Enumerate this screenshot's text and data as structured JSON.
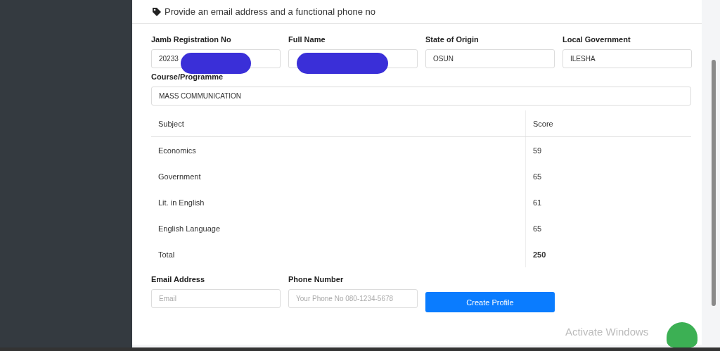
{
  "notice": "Provide an email address and a functional phone no",
  "fields": [
    {
      "label": "Jamb Registration No",
      "value": "20233",
      "redacted": true
    },
    {
      "label": "Full Name",
      "redacted": true
    },
    {
      "label": "State of Origin",
      "value": "OSUN",
      "redacted": false
    },
    {
      "label": "Local Government",
      "value": "ILESHA",
      "redacted": false
    }
  ],
  "course": {
    "label": "Course/Programme",
    "value": "MASS COMMUNICATION"
  },
  "table": {
    "columns": [
      "Subject",
      "Score"
    ],
    "rows": [
      {
        "subject": "Economics",
        "score": "59"
      },
      {
        "subject": "Government",
        "score": "65"
      },
      {
        "subject": "Lit. in English",
        "score": "61"
      },
      {
        "subject": "English Language",
        "score": "65"
      }
    ],
    "total": {
      "label": "Total",
      "score": "250"
    }
  },
  "contact": [
    {
      "label": "Email Address",
      "placeholder": "Email"
    },
    {
      "label": "Phone Number",
      "placeholder": "Your Phone No 080-1234-5678"
    }
  ],
  "submit": "Create Profile",
  "os_notice": "Activate Windows"
}
